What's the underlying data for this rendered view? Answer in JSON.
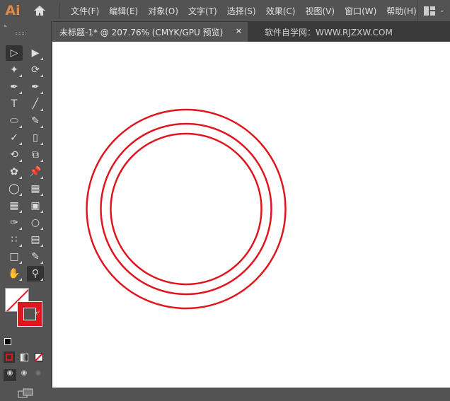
{
  "app": {
    "logo": "Ai"
  },
  "menu": [
    "文件(F)",
    "编辑(E)",
    "对象(O)",
    "文字(T)",
    "选择(S)",
    "效果(C)",
    "视图(V)",
    "窗口(W)",
    "帮助(H)"
  ],
  "document_tab": {
    "title": "未标题-1* @ 207.76% (CMYK/GPU 预览)",
    "close": "×"
  },
  "watermark": "软件自学网：WWW.RJZXW.COM",
  "tools": [
    "selection-tool",
    "direct-selection-tool",
    "magic-wand-tool",
    "lasso-tool",
    "pen-tool",
    "curvature-tool",
    "type-tool",
    "line-segment-tool",
    "ellipse-tool",
    "paintbrush-tool",
    "shaper-tool",
    "eraser-tool",
    "rotate-tool",
    "scale-tool",
    "puppet-warp-tool",
    "pin-tool",
    "shape-builder-tool",
    "perspective-grid-tool",
    "mesh-tool",
    "gradient-tool",
    "eyedropper-tool",
    "blend-tool",
    "symbol-sprayer-tool",
    "column-graph-tool",
    "artboard-tool",
    "slice-tool",
    "hand-tool",
    "zoom-tool"
  ],
  "colors": {
    "stroke": "#e0161e",
    "fill": "none",
    "circle_stroke": "#e0161e"
  },
  "artwork": {
    "circles": 3
  }
}
